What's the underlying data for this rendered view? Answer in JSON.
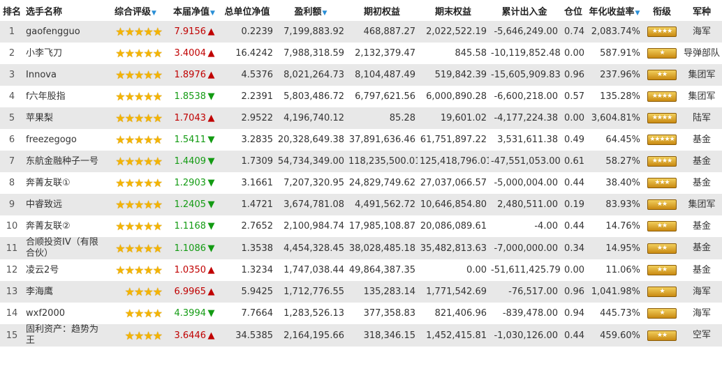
{
  "headers": {
    "rank": "排名",
    "name": "选手名称",
    "rating": "综合评级",
    "week_nav": "本届净值",
    "unit_nav": "总单位净值",
    "profit": "盈利额",
    "start_equity": "期初权益",
    "end_equity": "期末权益",
    "cum_flow": "累计出入金",
    "position": "仓位",
    "annual_return": "年化收益率",
    "title": "衔级",
    "army": "军种"
  },
  "sort_marker": "▼",
  "rows": [
    {
      "rank": "1",
      "name": "gaofengguo",
      "stars": 5,
      "week_nav": "7.9156",
      "dir": "up",
      "unit_nav": "0.2239",
      "profit": "7,199,883.92",
      "start_equity": "468,887.27",
      "end_equity": "2,022,522.19",
      "cum_flow": "-5,646,249.00",
      "position": "0.74",
      "annual_return": "2,083.74%",
      "badge": "★★★★",
      "army": "海军"
    },
    {
      "rank": "2",
      "name": "小李飞刀",
      "stars": 5,
      "week_nav": "3.4004",
      "dir": "up",
      "unit_nav": "16.4242",
      "profit": "7,988,318.59",
      "start_equity": "2,132,379.47",
      "end_equity": "845.58",
      "cum_flow": "-10,119,852.48",
      "position": "0.00",
      "annual_return": "587.91%",
      "badge": "★",
      "army": "导弹部队"
    },
    {
      "rank": "3",
      "name": "Innova",
      "stars": 5,
      "week_nav": "1.8976",
      "dir": "up",
      "unit_nav": "4.5376",
      "profit": "8,021,264.73",
      "start_equity": "8,104,487.49",
      "end_equity": "519,842.39",
      "cum_flow": "-15,605,909.83",
      "position": "0.96",
      "annual_return": "237.96%",
      "badge": "★★",
      "army": "集团军"
    },
    {
      "rank": "4",
      "name": "f六年股指",
      "stars": 5,
      "week_nav": "1.8538",
      "dir": "down",
      "unit_nav": "2.2391",
      "profit": "5,803,486.72",
      "start_equity": "6,797,621.56",
      "end_equity": "6,000,890.28",
      "cum_flow": "-6,600,218.00",
      "position": "0.57",
      "annual_return": "135.28%",
      "badge": "★★★★",
      "army": "集团军"
    },
    {
      "rank": "5",
      "name": "苹果梨",
      "stars": 5,
      "week_nav": "1.7043",
      "dir": "up",
      "unit_nav": "2.9522",
      "profit": "4,196,740.12",
      "start_equity": "85.28",
      "end_equity": "19,601.02",
      "cum_flow": "-4,177,224.38",
      "position": "0.00",
      "annual_return": "3,604.81%",
      "badge": "★★★★",
      "army": "陆军"
    },
    {
      "rank": "6",
      "name": "freezegogo",
      "stars": 5,
      "week_nav": "1.5411",
      "dir": "down",
      "unit_nav": "3.2835",
      "profit": "20,328,649.38",
      "start_equity": "37,891,636.46",
      "end_equity": "61,751,897.22",
      "cum_flow": "3,531,611.38",
      "position": "0.49",
      "annual_return": "64.45%",
      "badge": "★★★★★",
      "army": "基金"
    },
    {
      "rank": "7",
      "name": "东航金融种子一号",
      "stars": 5,
      "week_nav": "1.4409",
      "dir": "down",
      "unit_nav": "1.7309",
      "profit": "54,734,349.00",
      "start_equity": "118,235,500.01",
      "end_equity": "125,418,796.01",
      "cum_flow": "-47,551,053.00",
      "position": "0.61",
      "annual_return": "58.27%",
      "badge": "★★★★",
      "army": "基金"
    },
    {
      "rank": "8",
      "name": "奔菁友联①",
      "stars": 5,
      "week_nav": "1.2903",
      "dir": "down",
      "unit_nav": "3.1661",
      "profit": "7,207,320.95",
      "start_equity": "24,829,749.62",
      "end_equity": "27,037,066.57",
      "cum_flow": "-5,000,004.00",
      "position": "0.44",
      "annual_return": "38.40%",
      "badge": "★★★",
      "army": "基金"
    },
    {
      "rank": "9",
      "name": "中睿致远",
      "stars": 5,
      "week_nav": "1.2405",
      "dir": "down",
      "unit_nav": "1.4721",
      "profit": "3,674,781.08",
      "start_equity": "4,491,562.72",
      "end_equity": "10,646,854.80",
      "cum_flow": "2,480,511.00",
      "position": "0.19",
      "annual_return": "83.93%",
      "badge": "★★",
      "army": "集团军"
    },
    {
      "rank": "10",
      "name": "奔菁友联②",
      "stars": 5,
      "week_nav": "1.1168",
      "dir": "down",
      "unit_nav": "2.7652",
      "profit": "2,100,984.74",
      "start_equity": "17,985,108.87",
      "end_equity": "20,086,089.61",
      "cum_flow": "-4.00",
      "position": "0.44",
      "annual_return": "14.76%",
      "badge": "★★",
      "army": "基金"
    },
    {
      "rank": "11",
      "name": "合顺投资IV（有限合伙）",
      "stars": 5,
      "week_nav": "1.1086",
      "dir": "down",
      "unit_nav": "1.3538",
      "profit": "4,454,328.45",
      "start_equity": "38,028,485.18",
      "end_equity": "35,482,813.63",
      "cum_flow": "-7,000,000.00",
      "position": "0.34",
      "annual_return": "14.95%",
      "badge": "★★",
      "army": "基金"
    },
    {
      "rank": "12",
      "name": "凌云2号",
      "stars": 5,
      "week_nav": "1.0350",
      "dir": "up",
      "unit_nav": "1.3234",
      "profit": "1,747,038.44",
      "start_equity": "49,864,387.35",
      "end_equity": "0.00",
      "cum_flow": "-51,611,425.79",
      "position": "0.00",
      "annual_return": "11.06%",
      "badge": "★★",
      "army": "基金"
    },
    {
      "rank": "13",
      "name": "李海鹰",
      "stars": 4,
      "week_nav": "6.9965",
      "dir": "up",
      "unit_nav": "5.9425",
      "profit": "1,712,776.55",
      "start_equity": "135,283.14",
      "end_equity": "1,771,542.69",
      "cum_flow": "-76,517.00",
      "position": "0.96",
      "annual_return": "1,041.98%",
      "badge": "★",
      "army": "海军"
    },
    {
      "rank": "14",
      "name": "wxf2000",
      "stars": 4,
      "week_nav": "4.3994",
      "dir": "down",
      "unit_nav": "7.7664",
      "profit": "1,283,526.13",
      "start_equity": "377,358.83",
      "end_equity": "821,406.96",
      "cum_flow": "-839,478.00",
      "position": "0.94",
      "annual_return": "445.73%",
      "badge": "★",
      "army": "海军"
    },
    {
      "rank": "15",
      "name": "固利资产：趋势为王",
      "stars": 4,
      "week_nav": "3.6446",
      "dir": "up",
      "unit_nav": "34.5385",
      "profit": "2,164,195.66",
      "start_equity": "318,346.15",
      "end_equity": "1,452,415.81",
      "cum_flow": "-1,030,126.00",
      "position": "0.44",
      "annual_return": "459.60%",
      "badge": "★★",
      "army": "空军"
    }
  ],
  "colors": {
    "up": "#c00000",
    "down": "#139b13",
    "row_alt": "#e8e8e8",
    "star": "#f4b400",
    "sort": "#2a8fd6"
  },
  "icons": {
    "up": "arrow-up-icon",
    "down": "arrow-down-icon",
    "star": "star-icon",
    "badge": "rank-insignia-icon"
  }
}
